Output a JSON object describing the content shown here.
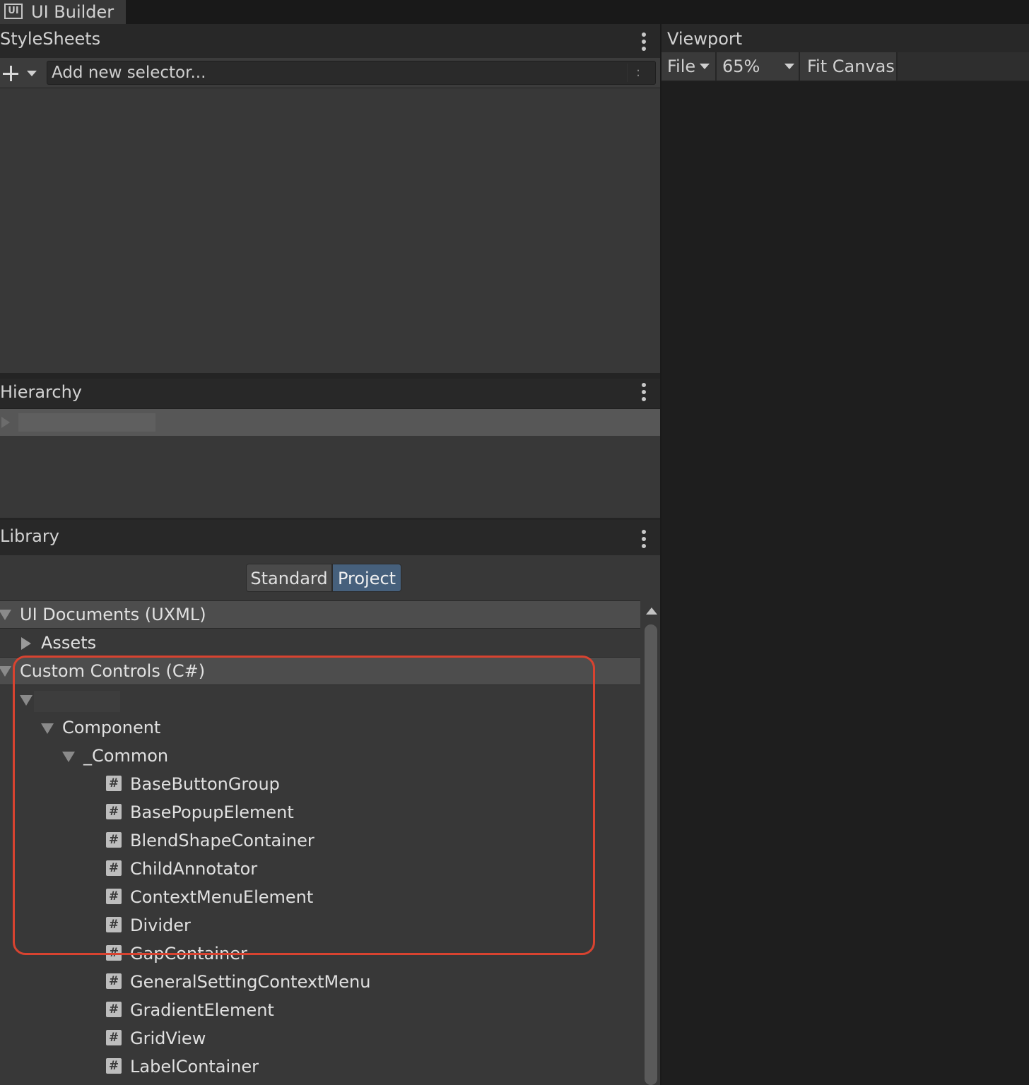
{
  "window": {
    "tab_title": "UI Builder",
    "tab_icon": "UI"
  },
  "stylesheets": {
    "title": "StyleSheets",
    "selector_placeholder": "Add new selector...",
    "field_menu_glyph": ":"
  },
  "hierarchy": {
    "title": "Hierarchy"
  },
  "library": {
    "title": "Library",
    "tabs": [
      "Standard",
      "Project"
    ],
    "active_tab": "Project",
    "categories": {
      "ui_documents": "UI Documents (UXML)",
      "assets": "Assets",
      "custom_controls": "Custom Controls (C#)",
      "component": "Component",
      "common": "_Common"
    },
    "hash_glyph": "#",
    "items": [
      "BaseButtonGroup",
      "BasePopupElement",
      "BlendShapeContainer",
      "ChildAnnotator",
      "ContextMenuElement",
      "Divider",
      "GapContainer",
      "GeneralSettingContextMenu",
      "GradientElement",
      "GridView",
      "LabelContainer"
    ]
  },
  "viewport": {
    "title": "Viewport",
    "file_menu": "File",
    "zoom": "65%",
    "fit_canvas": "Fit Canvas"
  },
  "colors": {
    "highlight_box": "#d84330",
    "active_tab": "#46607c",
    "panel_bg": "#383838",
    "viewport_bg": "#1e1e1e"
  }
}
